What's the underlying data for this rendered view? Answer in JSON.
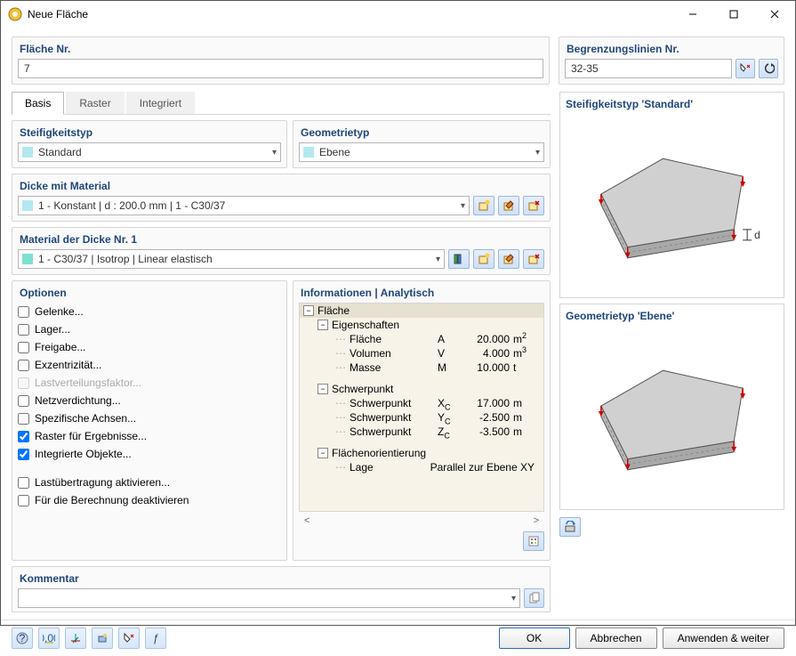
{
  "window": {
    "title": "Neue Fläche"
  },
  "flache_nr": {
    "label": "Fläche Nr.",
    "value": "7"
  },
  "begrenz": {
    "label": "Begrenzungslinien Nr.",
    "value": "32-35"
  },
  "tabs": {
    "basis": "Basis",
    "raster": "Raster",
    "integriert": "Integriert"
  },
  "stiff": {
    "header": "Steifigkeitstyp",
    "value": "Standard"
  },
  "geo": {
    "header": "Geometrietyp",
    "value": "Ebene"
  },
  "dicke": {
    "header": "Dicke mit Material",
    "value": "1 - Konstant | d : 200.0 mm | 1 - C30/37"
  },
  "material": {
    "header": "Material der Dicke Nr. 1",
    "value": "1 - C30/37 | Isotrop | Linear elastisch"
  },
  "options": {
    "header": "Optionen",
    "gelenke": "Gelenke...",
    "lager": "Lager...",
    "freigabe": "Freigabe...",
    "exzent": "Exzentrizität...",
    "lastvert": "Lastverteilungsfaktor...",
    "netz": "Netzverdichtung...",
    "achsen": "Spezifische Achsen...",
    "raster": "Raster für Ergebnisse...",
    "integ": "Integrierte Objekte...",
    "lastub": "Lastübertragung aktivieren...",
    "deakt": "Für die Berechnung deaktivieren"
  },
  "info": {
    "header": "Informationen | Analytisch",
    "flache": "Fläche",
    "eigen": "Eigenschaften",
    "flache_row": {
      "label": "Fläche",
      "sym": "A",
      "val": "20.000",
      "unit_html": "m<sup>2</sup>"
    },
    "volumen_row": {
      "label": "Volumen",
      "sym": "V",
      "val": "4.000",
      "unit_html": "m<sup>3</sup>"
    },
    "masse_row": {
      "label": "Masse",
      "sym": "M",
      "val": "10.000",
      "unit": "t"
    },
    "schwer": "Schwerpunkt",
    "sx": {
      "label": "Schwerpunkt",
      "sym_html": "X<sub>C</sub>",
      "val": "17.000",
      "unit": "m"
    },
    "sy": {
      "label": "Schwerpunkt",
      "sym_html": "Y<sub>C</sub>",
      "val": "-2.500",
      "unit": "m"
    },
    "sz": {
      "label": "Schwerpunkt",
      "sym_html": "Z<sub>C</sub>",
      "val": "-3.500",
      "unit": "m"
    },
    "orient": "Flächenorientierung",
    "lage": {
      "label": "Lage",
      "val": "Parallel zur Ebene XY"
    }
  },
  "kommentar": {
    "header": "Kommentar",
    "value": ""
  },
  "preview": {
    "stiff": "Steifigkeitstyp 'Standard'",
    "geo": "Geometrietyp 'Ebene'"
  },
  "footer": {
    "ok": "OK",
    "abbrechen": "Abbrechen",
    "anwenden": "Anwenden & weiter"
  }
}
